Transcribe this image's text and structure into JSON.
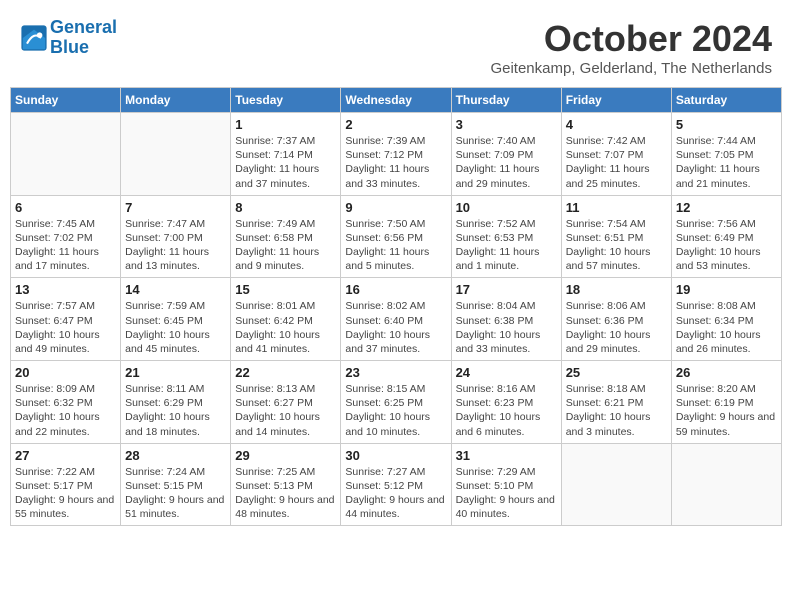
{
  "header": {
    "logo_line1": "General",
    "logo_line2": "Blue",
    "month": "October 2024",
    "location": "Geitenkamp, Gelderland, The Netherlands"
  },
  "weekdays": [
    "Sunday",
    "Monday",
    "Tuesday",
    "Wednesday",
    "Thursday",
    "Friday",
    "Saturday"
  ],
  "weeks": [
    [
      {
        "day": "",
        "info": ""
      },
      {
        "day": "",
        "info": ""
      },
      {
        "day": "1",
        "info": "Sunrise: 7:37 AM\nSunset: 7:14 PM\nDaylight: 11 hours and 37 minutes."
      },
      {
        "day": "2",
        "info": "Sunrise: 7:39 AM\nSunset: 7:12 PM\nDaylight: 11 hours and 33 minutes."
      },
      {
        "day": "3",
        "info": "Sunrise: 7:40 AM\nSunset: 7:09 PM\nDaylight: 11 hours and 29 minutes."
      },
      {
        "day": "4",
        "info": "Sunrise: 7:42 AM\nSunset: 7:07 PM\nDaylight: 11 hours and 25 minutes."
      },
      {
        "day": "5",
        "info": "Sunrise: 7:44 AM\nSunset: 7:05 PM\nDaylight: 11 hours and 21 minutes."
      }
    ],
    [
      {
        "day": "6",
        "info": "Sunrise: 7:45 AM\nSunset: 7:02 PM\nDaylight: 11 hours and 17 minutes."
      },
      {
        "day": "7",
        "info": "Sunrise: 7:47 AM\nSunset: 7:00 PM\nDaylight: 11 hours and 13 minutes."
      },
      {
        "day": "8",
        "info": "Sunrise: 7:49 AM\nSunset: 6:58 PM\nDaylight: 11 hours and 9 minutes."
      },
      {
        "day": "9",
        "info": "Sunrise: 7:50 AM\nSunset: 6:56 PM\nDaylight: 11 hours and 5 minutes."
      },
      {
        "day": "10",
        "info": "Sunrise: 7:52 AM\nSunset: 6:53 PM\nDaylight: 11 hours and 1 minute."
      },
      {
        "day": "11",
        "info": "Sunrise: 7:54 AM\nSunset: 6:51 PM\nDaylight: 10 hours and 57 minutes."
      },
      {
        "day": "12",
        "info": "Sunrise: 7:56 AM\nSunset: 6:49 PM\nDaylight: 10 hours and 53 minutes."
      }
    ],
    [
      {
        "day": "13",
        "info": "Sunrise: 7:57 AM\nSunset: 6:47 PM\nDaylight: 10 hours and 49 minutes."
      },
      {
        "day": "14",
        "info": "Sunrise: 7:59 AM\nSunset: 6:45 PM\nDaylight: 10 hours and 45 minutes."
      },
      {
        "day": "15",
        "info": "Sunrise: 8:01 AM\nSunset: 6:42 PM\nDaylight: 10 hours and 41 minutes."
      },
      {
        "day": "16",
        "info": "Sunrise: 8:02 AM\nSunset: 6:40 PM\nDaylight: 10 hours and 37 minutes."
      },
      {
        "day": "17",
        "info": "Sunrise: 8:04 AM\nSunset: 6:38 PM\nDaylight: 10 hours and 33 minutes."
      },
      {
        "day": "18",
        "info": "Sunrise: 8:06 AM\nSunset: 6:36 PM\nDaylight: 10 hours and 29 minutes."
      },
      {
        "day": "19",
        "info": "Sunrise: 8:08 AM\nSunset: 6:34 PM\nDaylight: 10 hours and 26 minutes."
      }
    ],
    [
      {
        "day": "20",
        "info": "Sunrise: 8:09 AM\nSunset: 6:32 PM\nDaylight: 10 hours and 22 minutes."
      },
      {
        "day": "21",
        "info": "Sunrise: 8:11 AM\nSunset: 6:29 PM\nDaylight: 10 hours and 18 minutes."
      },
      {
        "day": "22",
        "info": "Sunrise: 8:13 AM\nSunset: 6:27 PM\nDaylight: 10 hours and 14 minutes."
      },
      {
        "day": "23",
        "info": "Sunrise: 8:15 AM\nSunset: 6:25 PM\nDaylight: 10 hours and 10 minutes."
      },
      {
        "day": "24",
        "info": "Sunrise: 8:16 AM\nSunset: 6:23 PM\nDaylight: 10 hours and 6 minutes."
      },
      {
        "day": "25",
        "info": "Sunrise: 8:18 AM\nSunset: 6:21 PM\nDaylight: 10 hours and 3 minutes."
      },
      {
        "day": "26",
        "info": "Sunrise: 8:20 AM\nSunset: 6:19 PM\nDaylight: 9 hours and 59 minutes."
      }
    ],
    [
      {
        "day": "27",
        "info": "Sunrise: 7:22 AM\nSunset: 5:17 PM\nDaylight: 9 hours and 55 minutes."
      },
      {
        "day": "28",
        "info": "Sunrise: 7:24 AM\nSunset: 5:15 PM\nDaylight: 9 hours and 51 minutes."
      },
      {
        "day": "29",
        "info": "Sunrise: 7:25 AM\nSunset: 5:13 PM\nDaylight: 9 hours and 48 minutes."
      },
      {
        "day": "30",
        "info": "Sunrise: 7:27 AM\nSunset: 5:12 PM\nDaylight: 9 hours and 44 minutes."
      },
      {
        "day": "31",
        "info": "Sunrise: 7:29 AM\nSunset: 5:10 PM\nDaylight: 9 hours and 40 minutes."
      },
      {
        "day": "",
        "info": ""
      },
      {
        "day": "",
        "info": ""
      }
    ]
  ]
}
